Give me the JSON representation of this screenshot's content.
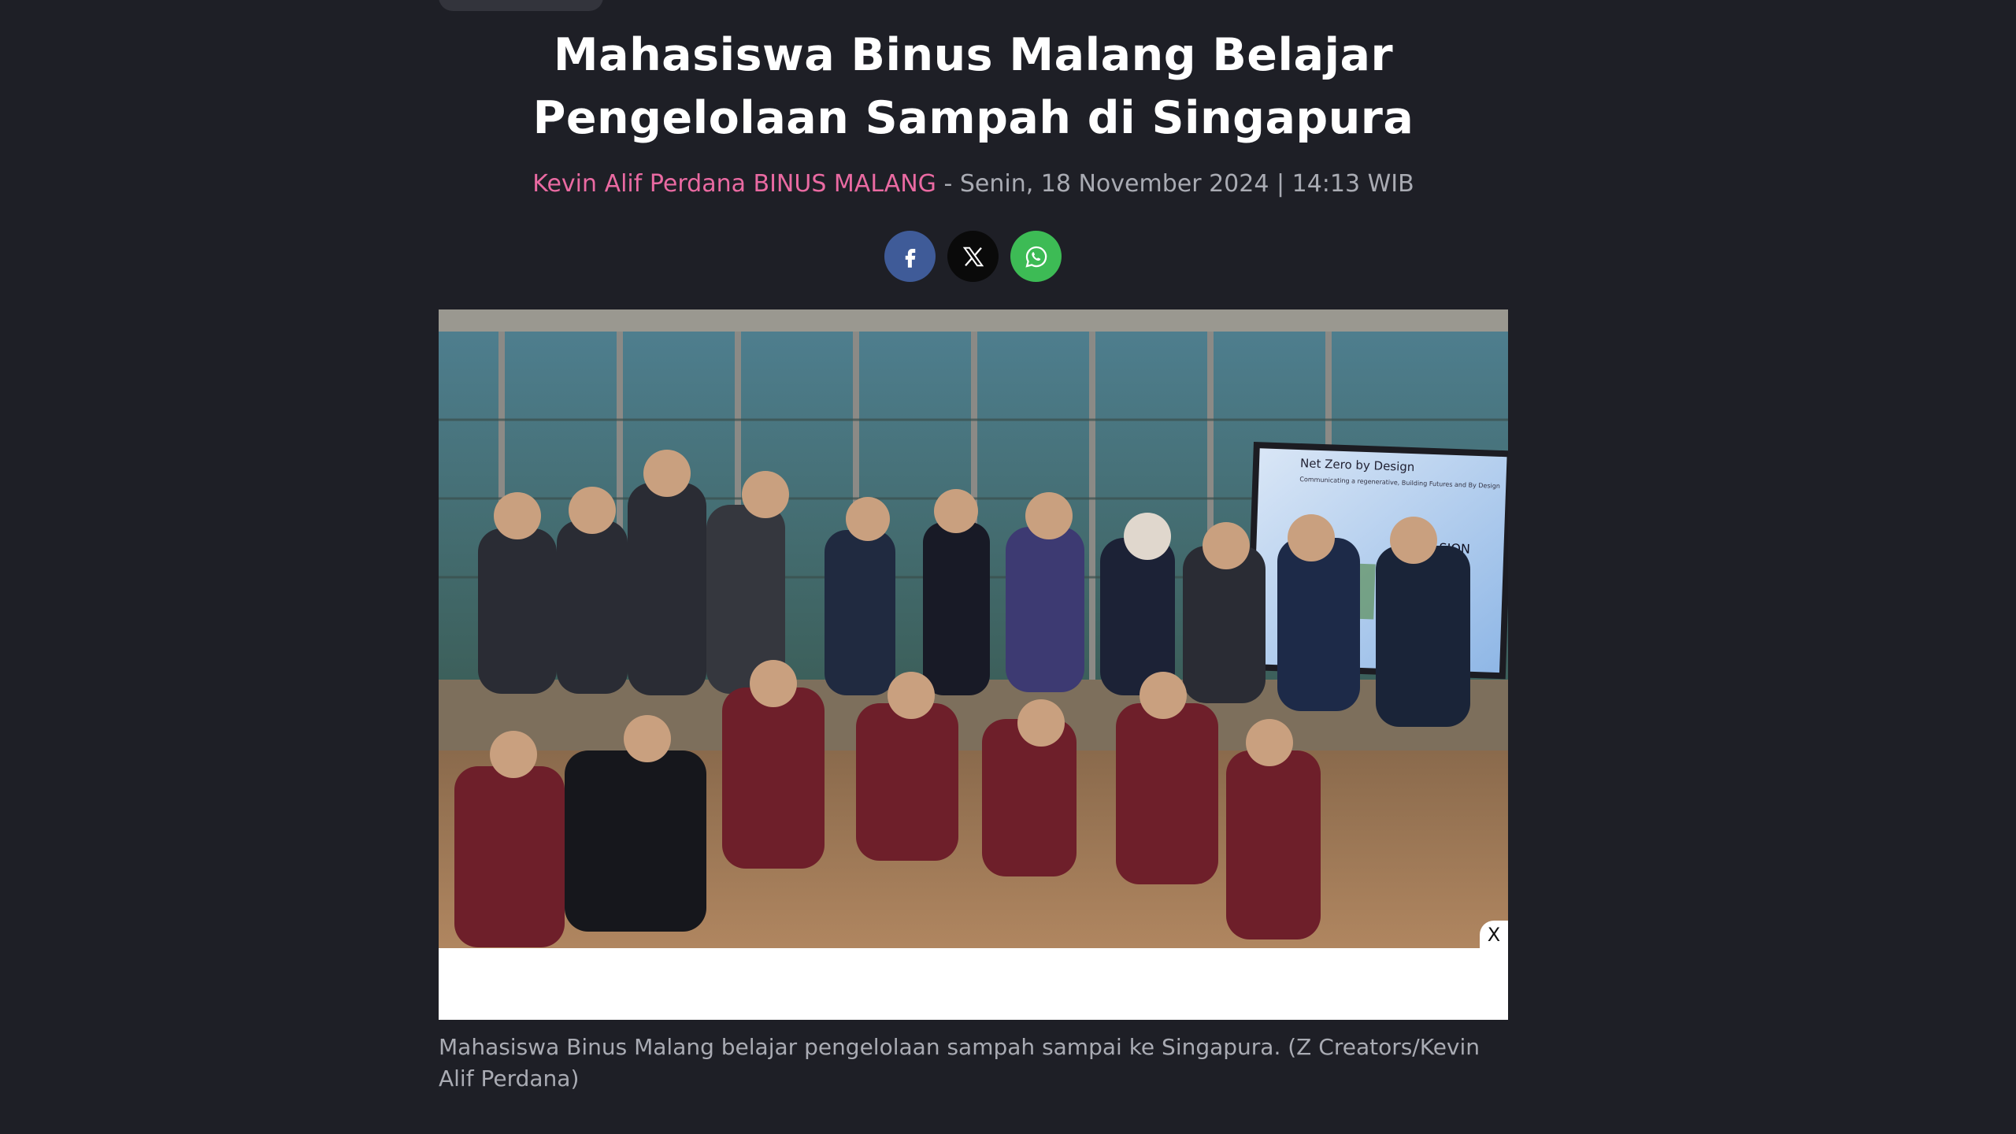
{
  "article": {
    "title_line1": "Mahasiswa Binus Malang Belajar",
    "title_line2": "Pengelolaan Sampah di Singapura",
    "author": "Kevin Alif Perdana BINUS MALANG",
    "separator": " - ",
    "date": "Senin, 18 November 2024 | 14:13 WIB"
  },
  "share": {
    "buttons": [
      {
        "name": "facebook",
        "icon": "facebook-icon",
        "color": "#3f5b98"
      },
      {
        "name": "x",
        "icon": "x-icon",
        "color": "#0a0a0a"
      },
      {
        "name": "whatsapp",
        "icon": "whatsapp-icon",
        "color": "#3dbb55"
      }
    ]
  },
  "figure": {
    "close_label": "X",
    "screen_text": "Net Zero by Design",
    "screen_sub": "Communicating a regenerative, Building Futures and By Design",
    "screen_word": "SION",
    "caption": "Mahasiswa Binus Malang belajar pengelolaan sampah sampai ke Singapura. (Z Creators/Kevin Alif Perdana)"
  },
  "colors": {
    "background": "#1e1f26",
    "author": "#ea6aa2",
    "meta": "#a9abb3",
    "title": "#ffffff"
  }
}
